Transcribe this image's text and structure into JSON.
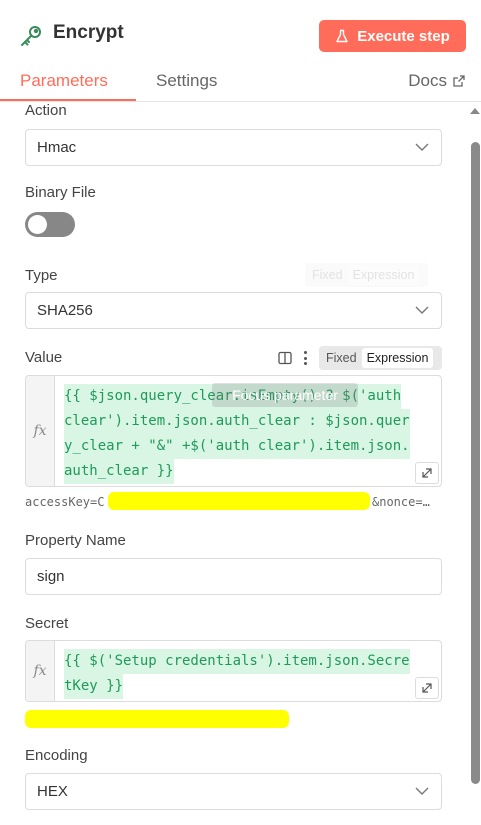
{
  "header": {
    "title": "Encrypt",
    "execute_label": "Execute step"
  },
  "tabs": {
    "parameters": "Parameters",
    "settings": "Settings",
    "docs": "Docs"
  },
  "fields": {
    "action": {
      "label": "Action",
      "value": "Hmac"
    },
    "binary_file": {
      "label": "Binary File",
      "enabled": false
    },
    "type": {
      "label": "Type",
      "value": "SHA256",
      "mode_fixed": "Fixed",
      "mode_expression": "Expression"
    },
    "value": {
      "label": "Value",
      "mode_fixed": "Fixed",
      "mode_expression": "Expression",
      "fx": "fx",
      "code_lines": [
        "{{ $json.query_clear.isEmpty() ? $('auth",
        "clear').item.json.auth_clear : $json.quer",
        "y_clear + \"&\" +$('auth clear').item.json.",
        "auth_clear }}"
      ],
      "result_prefix": "accessKey=C",
      "result_suffix": "&nonce=…",
      "tooltip": "Focus parameter"
    },
    "property_name": {
      "label": "Property Name",
      "value": "sign"
    },
    "secret": {
      "label": "Secret",
      "fx": "fx",
      "code_lines": [
        "{{ $('Setup credentials').item.json.Secre",
        "tKey }}"
      ]
    },
    "encoding": {
      "label": "Encoding",
      "value": "HEX"
    }
  },
  "colors": {
    "accent": "#ff6d5a",
    "expression_green": "#1f9a5a",
    "expression_bg": "#d9f5e4",
    "redaction": "#ffff00"
  },
  "icons": {
    "title": "key-icon",
    "execute": "flask-icon",
    "docs": "external-link-icon",
    "select": "chevron-down-icon",
    "expand": "open-editor-icon",
    "panel": "panel-icon"
  }
}
